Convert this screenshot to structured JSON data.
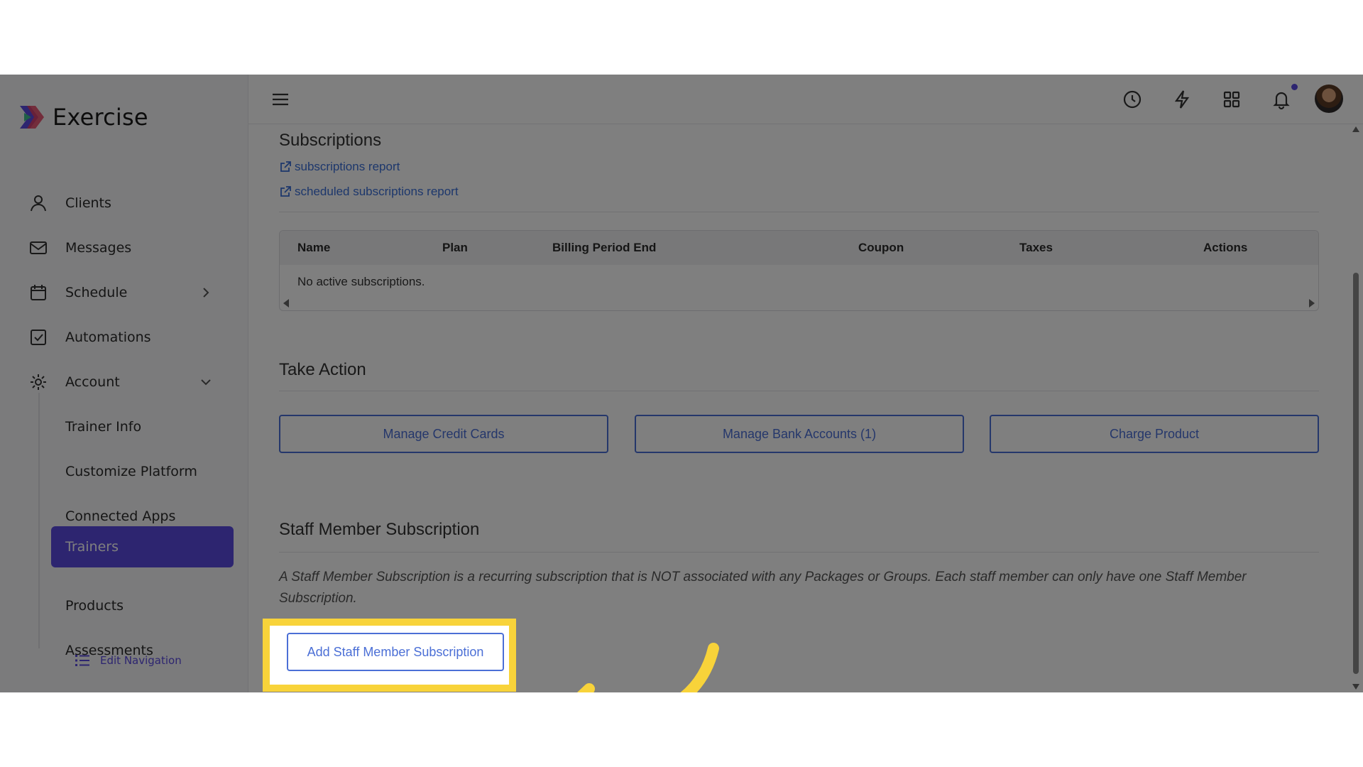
{
  "app": {
    "name": "Exercise"
  },
  "sidebar": {
    "items": [
      {
        "label": "Clients",
        "icon": "user-icon"
      },
      {
        "label": "Messages",
        "icon": "mail-icon"
      },
      {
        "label": "Schedule",
        "icon": "calendar-icon"
      },
      {
        "label": "Automations",
        "icon": "checkbox-icon"
      },
      {
        "label": "Account",
        "icon": "gear-icon"
      }
    ],
    "account_sub": [
      {
        "label": "Trainer Info"
      },
      {
        "label": "Customize Platform"
      },
      {
        "label": "Connected Apps"
      },
      {
        "label": "Trainers",
        "active": true
      },
      {
        "label": "Products"
      },
      {
        "label": "Assessments"
      }
    ],
    "edit_nav": "Edit Navigation"
  },
  "topbar": {
    "icons": [
      "menu-icon",
      "clock-icon",
      "lightning-icon",
      "grid-icon",
      "bell-icon"
    ],
    "has_notification": true
  },
  "subscriptions": {
    "title": "Subscriptions",
    "links": [
      "subscriptions report",
      "scheduled subscriptions report"
    ],
    "table": {
      "columns": [
        "Name",
        "Plan",
        "Billing Period End",
        "Coupon",
        "Taxes",
        "Actions"
      ],
      "empty_text": "No active subscriptions."
    }
  },
  "take_action": {
    "title": "Take Action",
    "buttons": [
      "Manage Credit Cards",
      "Manage Bank Accounts (1)",
      "Charge Product"
    ]
  },
  "staff_subscription": {
    "title": "Staff Member Subscription",
    "description": "A Staff Member Subscription is a recurring subscription that is NOT associated with any Packages or Groups. Each staff member can only have one Staff Member Subscription.",
    "button": "Add Staff Member Subscription"
  },
  "colors": {
    "accent": "#5b4be0",
    "link": "#3a6fd8",
    "highlight": "#f8d33a"
  }
}
